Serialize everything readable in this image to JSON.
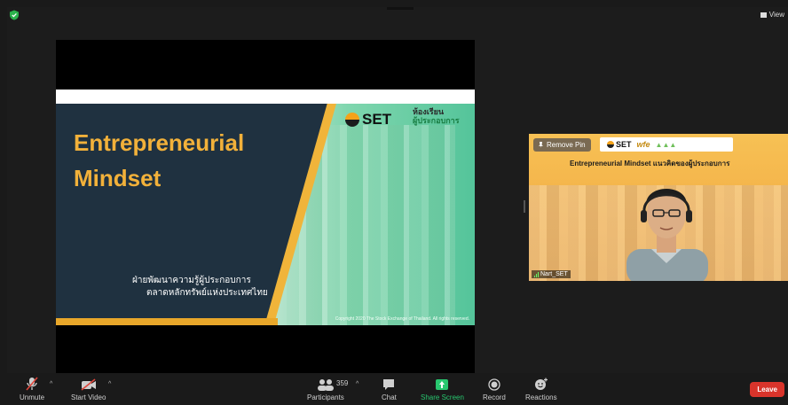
{
  "window": {
    "view_label": "View"
  },
  "slide": {
    "title_line1": "Entrepreneurial",
    "title_line2": "Mindset",
    "thai_line1": "ฝ่ายพัฒนาความรู้ผู้ประกอบการ",
    "thai_line2": "ตลาดหลักทรัพย์แห่งประเทศไทย",
    "logo_set": "SET",
    "logo_class_line1": "ห้องเรียน",
    "logo_class_line2": "ผู้ประกอบการ",
    "copyright": "Copyright 2020 The Stock Exchange of Thailand. All rights reserved."
  },
  "video": {
    "remove_pin_label": "Remove Pin",
    "header_set": "SET",
    "header_wfe": "wfe",
    "subtitle": "Entrepreneurial Mindset แนวคิดของผู้ประกอบการ",
    "participant_name": "Nart_SET"
  },
  "toolbar": {
    "unmute": "Unmute",
    "start_video": "Start Video",
    "participants": "Participants",
    "participants_count": "359",
    "chat": "Chat",
    "share_screen": "Share Screen",
    "record": "Record",
    "reactions": "Reactions",
    "leave": "Leave"
  },
  "colors": {
    "background": "#1c1c1c",
    "share_green": "#28c76f",
    "leave_red": "#d9342b",
    "slide_navy": "#1f3140",
    "slide_gold": "#f2b13a"
  }
}
